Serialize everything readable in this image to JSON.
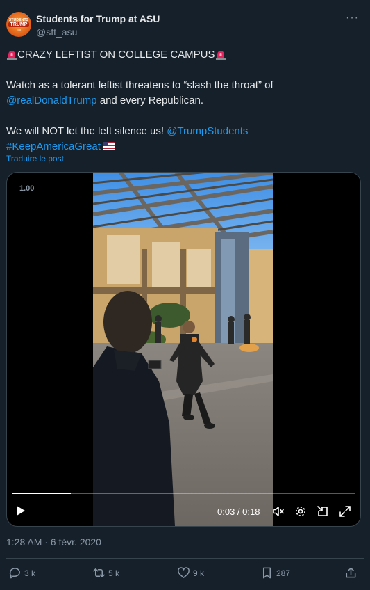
{
  "author": {
    "name": "Students for Trump at ASU",
    "handle": "@sft_asu",
    "avatar_text": [
      "STUDENTS",
      "TRUMP",
      "FOR"
    ]
  },
  "more_icon": "ellipsis-icon",
  "tweet": {
    "line1": "CRAZY LEFTIST ON COLLEGE CAMPUS",
    "line2_a": "Watch as a tolerant leftist threatens to “slash the throat” of",
    "mention1": "@realDonaldTrump",
    "line2_b": " and every Republican.",
    "line3_a": "We will NOT let the left silence us! ",
    "mention2": "@TrumpStudents",
    "hashtag": "#KeepAmericaGreat",
    "emoji": [
      "siren-icon",
      "us-flag-icon"
    ]
  },
  "translate_label": "Traduire le post",
  "video": {
    "speed": "1.00",
    "time": "0:03 / 0:18",
    "progress": 0.17,
    "controls": [
      "play-icon",
      "mute-icon",
      "settings-icon",
      "pip-icon",
      "fullscreen-icon"
    ]
  },
  "timestamp": "1:28 AM · 6 févr. 2020",
  "actions": {
    "replies": "3 k",
    "reposts": "5 k",
    "likes": "9 k",
    "bookmarks": "287"
  },
  "colors": {
    "background": "#15202b",
    "link": "#1d9bf0",
    "muted": "#8b98a5",
    "text": "#e7e9ea"
  }
}
